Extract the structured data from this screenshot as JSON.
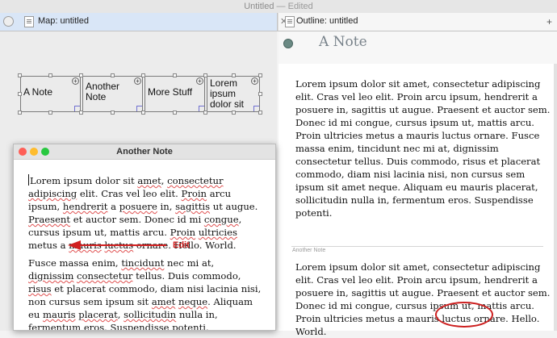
{
  "window": {
    "title": "Untitled",
    "status": "— Edited"
  },
  "tabs": [
    {
      "label": "Map: untitled"
    },
    {
      "label": "Outline: untitled"
    }
  ],
  "map": {
    "nodes": [
      {
        "label": "A Note"
      },
      {
        "label": "Another Note"
      },
      {
        "label": "More Stuff"
      },
      {
        "label": "Lorem ipsum dolor sit"
      }
    ]
  },
  "note_window": {
    "title": "Another Note",
    "p1_words": [
      "Lorem ipsum dolor sit ",
      "amet",
      ", ",
      "consectetur",
      " ",
      "adipiscing",
      " elit. Cras vel leo elit. ",
      "Proin",
      " arcu ipsum, ",
      "hendrerit",
      " a ",
      "posuere",
      " in, ",
      "sagittis",
      " ut augue. ",
      "Praesent",
      " et auctor sem. Donec id mi ",
      "congue",
      ", cursus ipsum ut, mattis arcu. ",
      "Proin",
      " ",
      "ultricies",
      " metus a ",
      "mauris",
      " ",
      "luctus",
      " ornare. Hello. World."
    ],
    "p2_words": [
      "Fusce massa enim, ",
      "tincidunt",
      " nec mi at, ",
      "dignissim",
      " ",
      "consectetur",
      " tellus. Duis commodo, ",
      "risus",
      " et placerat commodo, diam nisi lacinia nisi, non cursus sem ipsum sit ",
      "amet",
      " ",
      "neque",
      ". Aliquam eu ",
      "mauris",
      " ",
      "placerat",
      ", ",
      "sollicitudin",
      " nulla in, fermentum eros. Suspendisse potenti."
    ],
    "annotation": "Edit"
  },
  "outline": {
    "title": "A Note",
    "text1": "Lorem ipsum dolor sit amet, consectetur adipiscing elit. Cras vel leo elit. Proin arcu ipsum, hendrerit a posuere in, sagittis ut augue. Praesent et auctor sem. Donec id mi congue, cursus ipsum ut, mattis arcu. Proin ultricies metus a mauris luctus ornare. Fusce massa enim, tincidunt nec mi at, dignissim consectetur tellus. Duis commodo, risus et placerat commodo, diam nisi lacinia nisi, non cursus sem ipsum sit amet neque. Aliquam eu mauris placerat, sollicitudin nulla in, fermentum eros. Suspendisse potenti.",
    "subheading": "Another Note",
    "text2": "Lorem ipsum dolor sit amet, consectetur adipiscing elit. Cras vel leo elit. Proin arcu ipsum, hendrerit a posuere in, sagittis ut augue. Praesent et auctor sem. Donec id mi congue, cursus ipsum ut, mattis arcu. Proin ultricies metus a mauris luctus ornare. Hello. World."
  },
  "colors": {
    "annotation_red": "#cc1f1f",
    "tab_active": "#d9e6f7"
  }
}
